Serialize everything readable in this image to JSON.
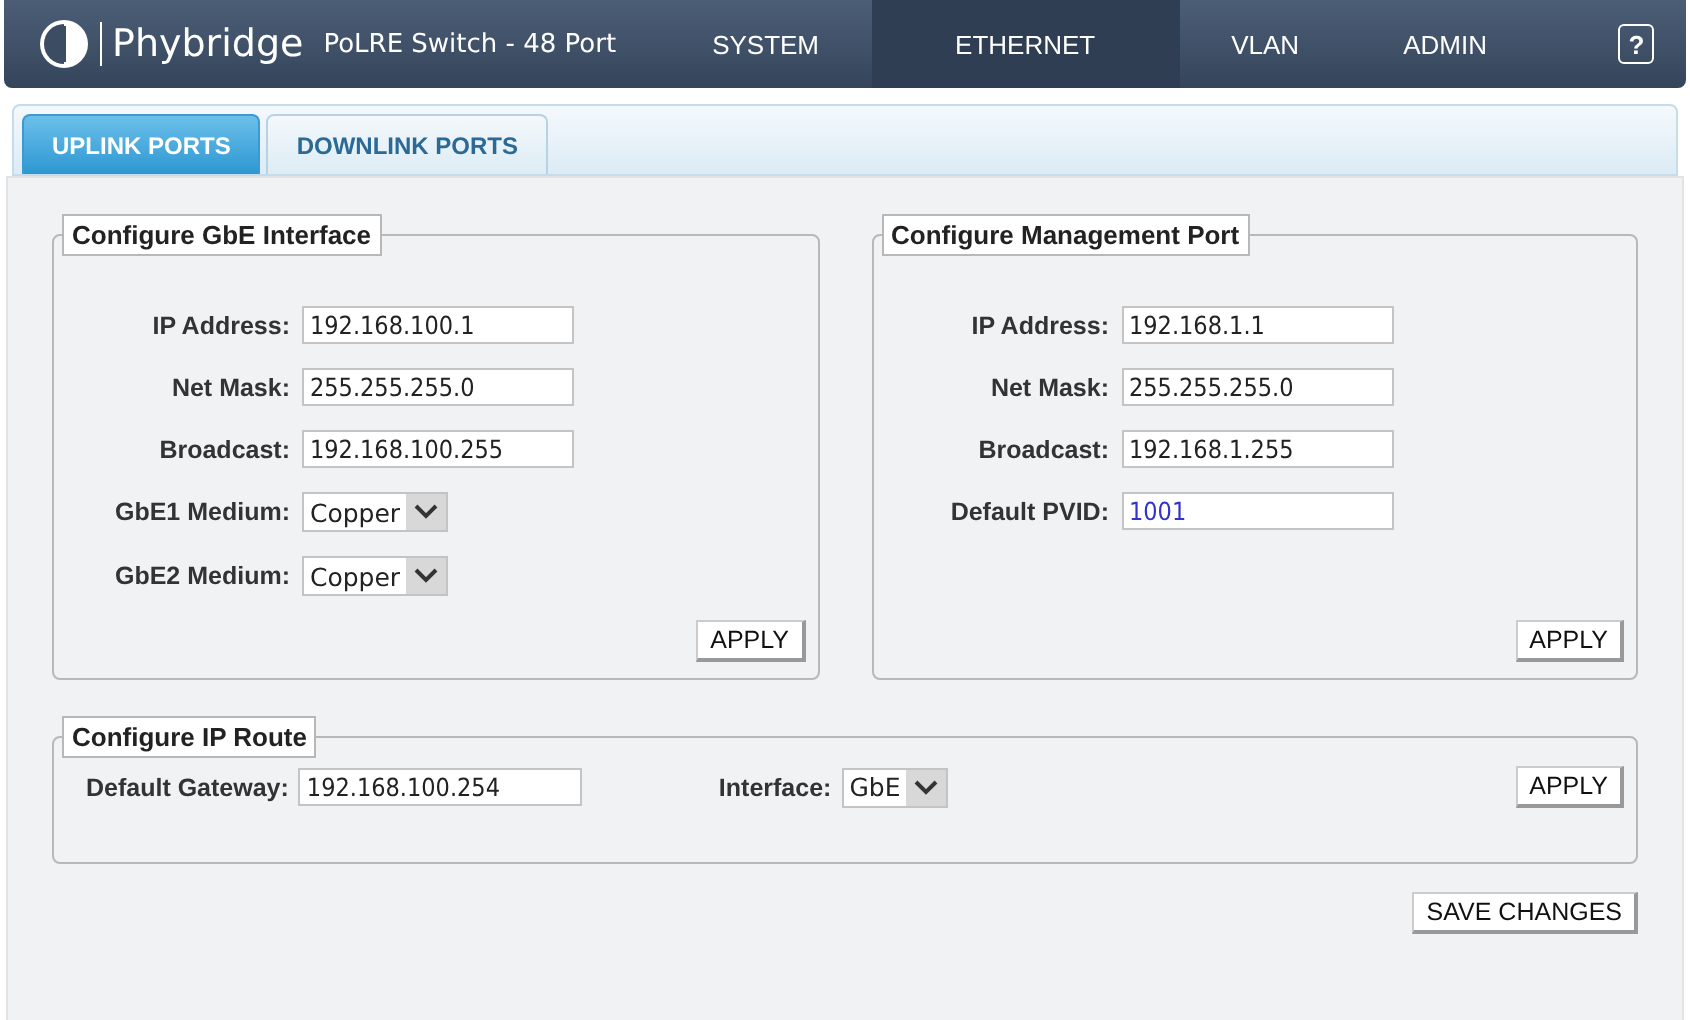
{
  "header": {
    "brand": "Phybridge",
    "product": "PoLRE Switch - 48 Port",
    "nav": [
      {
        "label": "SYSTEM",
        "selected": false
      },
      {
        "label": "ETHERNET",
        "selected": true
      },
      {
        "label": "VLAN",
        "selected": false
      },
      {
        "label": "ADMIN",
        "selected": false
      }
    ],
    "help": "?"
  },
  "tabs": [
    {
      "label": "UPLINK PORTS",
      "selected": true
    },
    {
      "label": "DOWNLINK PORTS",
      "selected": false
    }
  ],
  "panels": [
    {
      "title": "Configure GbE Interface",
      "fields": [
        {
          "label": "IP Address:",
          "kind": "text",
          "value": "192.168.100.1"
        },
        {
          "label": "Net Mask:",
          "kind": "text",
          "value": "255.255.255.0"
        },
        {
          "label": "Broadcast:",
          "kind": "text",
          "value": "192.168.100.255"
        },
        {
          "label": "GbE1 Medium:",
          "kind": "select",
          "value": "Copper"
        },
        {
          "label": "GbE2 Medium:",
          "kind": "select",
          "value": "Copper"
        }
      ],
      "button": "APPLY"
    },
    {
      "title": "Configure Management Port",
      "fields": [
        {
          "label": "IP Address:",
          "kind": "text",
          "value": "192.168.1.1"
        },
        {
          "label": "Net Mask:",
          "kind": "text",
          "value": "255.255.255.0"
        },
        {
          "label": "Broadcast:",
          "kind": "text",
          "value": "192.168.1.255"
        },
        {
          "label": "Default PVID:",
          "kind": "number",
          "value": "1001"
        }
      ],
      "button": "APPLY"
    }
  ],
  "route": {
    "title": "Configure IP Route",
    "fields": [
      {
        "label": "Default Gateway:",
        "kind": "text",
        "value": "192.168.100.254"
      },
      {
        "label": "Interface:",
        "kind": "select",
        "value": "GbE"
      }
    ],
    "button": "APPLY"
  },
  "save_button": "SAVE CHANGES"
}
